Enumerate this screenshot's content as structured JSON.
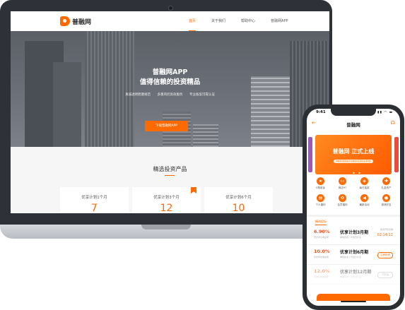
{
  "site": {
    "logo_text": "普融网",
    "nav": [
      {
        "label": "首页",
        "active": true
      },
      {
        "label": "关于我们",
        "active": false
      },
      {
        "label": "帮助中心",
        "active": false
      },
      {
        "label": "普融网APP",
        "active": false
      }
    ],
    "hero": {
      "title_line1": "普融网APP",
      "title_line2": "值得信赖的投资精品",
      "features": [
        "真诚透明稳健规范",
        "多重风控高效服务",
        "专业备案可靠认证"
      ],
      "download_button": "下载普融网APP"
    },
    "products": {
      "section_title": "精选投资产品",
      "cards": [
        {
          "name": "优享计划1个月",
          "rate": "7"
        },
        {
          "name": "优享计划3个月",
          "rate": "12"
        },
        {
          "name": "优享计划6个月",
          "rate": "10"
        }
      ]
    }
  },
  "app": {
    "status_time": "9:41",
    "title": "普融网",
    "banner": {
      "text": "普融网 正式上线",
      "pill": "新版本全新升级 产品更加丰富 更加安全可靠"
    },
    "grid": [
      {
        "label": "0撸拿返",
        "icon": "★"
      },
      {
        "label": "商店97",
        "icon": "▭"
      },
      {
        "label": "每日抽奖",
        "icon": "◈"
      },
      {
        "label": "礼金资产",
        "icon": "✚"
      },
      {
        "label": "个人福利",
        "icon": "▤"
      },
      {
        "label": "会员福利",
        "icon": "✿"
      },
      {
        "label": "最新活动",
        "icon": "◀"
      },
      {
        "label": "邀请好友",
        "icon": "●"
      }
    ],
    "tab": "精选投标",
    "products": [
      {
        "rate": "6.90%",
        "rate_label": "历史年化收益率",
        "name": "优享计划3月期",
        "meta": "单笔投资 | 可当日计息",
        "right_label": "距离开售仅剩",
        "right_value": "02:14:12",
        "type": "countdown"
      },
      {
        "rate": "10.0%",
        "rate_label": "历史年化收益率",
        "name": "优享计划6月期",
        "meta": "单笔投资 | 可当日计息",
        "right_value": "立即投资",
        "type": "chip"
      },
      {
        "rate": "12.0%",
        "rate_label": "历史年化收益率",
        "name": "优享计划12月期",
        "meta": "单笔投资 | 可当日计息",
        "right_value": "已售罄",
        "type": "chip-gray"
      }
    ]
  },
  "colors": {
    "accent": "#ff6a00",
    "device": "#2e3138"
  }
}
